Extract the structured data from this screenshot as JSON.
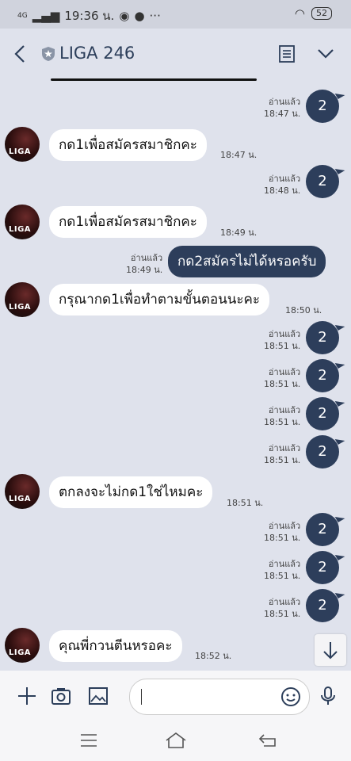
{
  "status_bar": {
    "network": "4G",
    "time": "19:36 น.",
    "battery": "52"
  },
  "header": {
    "title": "LIGA 246"
  },
  "avatar_label": "LIGA",
  "messages": {
    "r1": {
      "read": "อ่านแล้ว",
      "time": "18:47 น.",
      "sticker": "2"
    },
    "i1": {
      "text": "กด1เพื่อสมัครสมาชิกคะ",
      "time": "18:47 น."
    },
    "r2": {
      "read": "อ่านแล้ว",
      "time": "18:48 น.",
      "sticker": "2"
    },
    "i2": {
      "text": "กด1เพื่อสมัครสมาชิกคะ",
      "time": "18:49 น."
    },
    "o1": {
      "read": "อ่านแล้ว",
      "time": "18:49 น.",
      "text": "กด2สมัครไม่ได้หรอครับ"
    },
    "i3": {
      "text": "กรุณากด1เพื่อทำตามขั้นตอนนะคะ",
      "time": "18:50 น."
    },
    "r3": {
      "read": "อ่านแล้ว",
      "time": "18:51 น.",
      "sticker": "2"
    },
    "r4": {
      "read": "อ่านแล้ว",
      "time": "18:51 น.",
      "sticker": "2"
    },
    "r5": {
      "read": "อ่านแล้ว",
      "time": "18:51 น.",
      "sticker": "2"
    },
    "r6": {
      "read": "อ่านแล้ว",
      "time": "18:51 น.",
      "sticker": "2"
    },
    "i4": {
      "text": "ตกลงจะไม่กด1ใช่ไหมคะ",
      "time": "18:51 น."
    },
    "r7": {
      "read": "อ่านแล้ว",
      "time": "18:51 น.",
      "sticker": "2"
    },
    "r8": {
      "read": "อ่านแล้ว",
      "time": "18:51 น.",
      "sticker": "2"
    },
    "r9": {
      "read": "อ่านแล้ว",
      "time": "18:51 น.",
      "sticker": "2"
    },
    "i5": {
      "text": "คุณพี่กวนตีนหรอคะ",
      "time": "18:52 น."
    }
  },
  "colors": {
    "background": "#dfe2ec",
    "outgoing": "#2d3e5b",
    "incoming": "#ffffff"
  }
}
